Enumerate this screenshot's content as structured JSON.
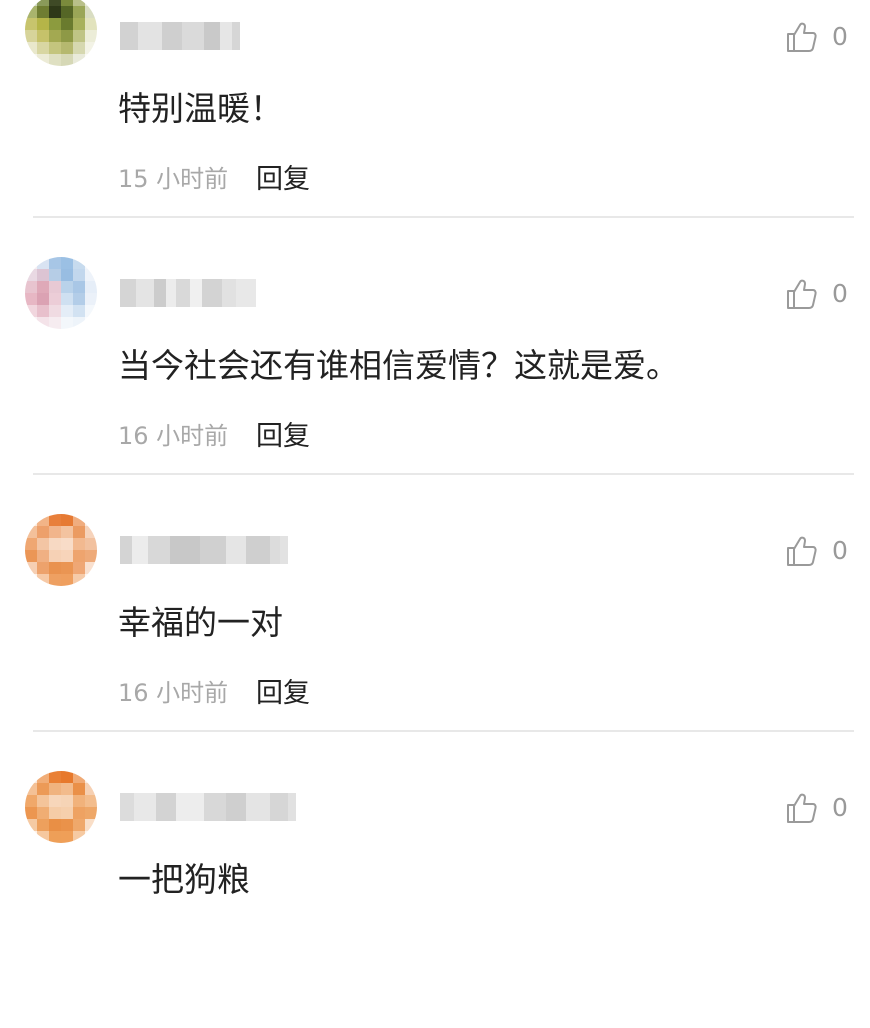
{
  "comments": [
    {
      "username": "",
      "content": "特别温暖！",
      "time": "15 小时前",
      "reply_label": "回复",
      "like_count": "0",
      "avatar_colors": [
        "#cfd8c4",
        "#8a9a5a",
        "#3f4a26",
        "#7b8a3c",
        "#b9c08a",
        "#e6ead6",
        "#a9b46d",
        "#6f7d32",
        "#2e3818",
        "#556626",
        "#9aa657",
        "#d9ddc2",
        "#c7c46d",
        "#b5b548",
        "#8c9b3e",
        "#6a7b2e",
        "#a8b15c",
        "#e2e3bd",
        "#d7d49a",
        "#c6c26a",
        "#a3a951",
        "#8e9946",
        "#bfc485",
        "#ecedd8",
        "#e9e8cc",
        "#d8d6a2",
        "#c4c57e",
        "#b5b86f",
        "#d6d8b0",
        "#f3f3e6",
        "#f6f6ee",
        "#ecebd6",
        "#dfe0c2",
        "#d6d8b6",
        "#e9eada",
        "#fafaf5"
      ],
      "name_colors": [
        "#d2d2d2",
        "#e3e3e3",
        "#cfcfcf",
        "#dadada",
        "#c9c9c9",
        "#e6e6e6",
        "#d6d6d6"
      ]
    },
    {
      "username": "",
      "content": "当今社会还有谁相信爱情？这就是爱。",
      "time": "16 小时前",
      "reply_label": "回复",
      "like_count": "0",
      "avatar_colors": [
        "#f4eef2",
        "#d9e3f2",
        "#a7c6e6",
        "#9bc0e4",
        "#c7dbee",
        "#f2f6fb",
        "#e9d9e3",
        "#dcc4d3",
        "#b6cde6",
        "#98bde2",
        "#c2d7ed",
        "#eef3fa",
        "#e8c4cf",
        "#dfa9b8",
        "#e8c9d4",
        "#b9d2ea",
        "#a9c7e6",
        "#e6eef8",
        "#e7b7c4",
        "#dba2b3",
        "#eccdd7",
        "#cfe0f1",
        "#b3cde8",
        "#ebf1f9",
        "#f1d6de",
        "#e8c0cc",
        "#f0dbe2",
        "#e4edf7",
        "#d2e2f2",
        "#f4f8fc",
        "#faf2f5",
        "#f4e3e9",
        "#f6ecf0",
        "#f3f7fb",
        "#eef4fa",
        "#fbfcfe"
      ],
      "name_colors": [
        "#d5d5d5",
        "#e4e4e4",
        "#cccccc",
        "#ececec",
        "#d9d9d9",
        "#f0f0f0",
        "#d3d3d3",
        "#e1e1e1",
        "#e8e8e8"
      ]
    },
    {
      "username": "",
      "content": "幸福的一对",
      "time": "16 小时前",
      "reply_label": "回复",
      "like_count": "0",
      "avatar_colors": [
        "#fbe9dc",
        "#f2b487",
        "#e87f3b",
        "#e67a33",
        "#f0ad7f",
        "#fbeadf",
        "#f3c09a",
        "#eda06b",
        "#f1b58c",
        "#f3c3a0",
        "#eb9b62",
        "#f6d3bb",
        "#efa772",
        "#f3c5a4",
        "#f7d9c3",
        "#f8dcc8",
        "#f2b990",
        "#f2c19f",
        "#eb9656",
        "#f0b083",
        "#f6d1b5",
        "#f7d4ba",
        "#eea46e",
        "#eeaa79",
        "#f6cfb3",
        "#eda26c",
        "#e9924f",
        "#ea9553",
        "#efa775",
        "#f9e0cf",
        "#fdf3ec",
        "#f6c9a6",
        "#eea062",
        "#ef9f5f",
        "#f6cba9",
        "#fdf4ee"
      ],
      "name_colors": [
        "#d4d4d4",
        "#ececec",
        "#d8d8d8",
        "#c8c8c8",
        "#d0d0d0",
        "#e5e5e5",
        "#cfcfcf",
        "#dcdcdc",
        "#e2e2e2"
      ]
    },
    {
      "username": "",
      "content": "一把狗粮",
      "time": "",
      "reply_label": "",
      "like_count": "0",
      "avatar_colors": [
        "#fbe6d6",
        "#f1ad77",
        "#e98035",
        "#e7792c",
        "#f0aa75",
        "#fbe8da",
        "#f4c196",
        "#ec9a57",
        "#f0b37f",
        "#f2bb8c",
        "#ea9048",
        "#f6d0b2",
        "#f0a86a",
        "#f4c49a",
        "#f7d6ba",
        "#f6d4b6",
        "#f1b27b",
        "#f3bd8d",
        "#ec9650",
        "#f0ad73",
        "#f5cca7",
        "#f6cfac",
        "#eea262",
        "#eea768",
        "#f5caa3",
        "#eda05d",
        "#e98f45",
        "#ea924a",
        "#efa86b",
        "#f9dec7",
        "#fdf1e7",
        "#f6c89f",
        "#ee9f58",
        "#ef9f58",
        "#f6caa2",
        "#fdf3eb"
      ],
      "name_colors": [
        "#dcdcdc",
        "#e8e8e8",
        "#d3d3d3",
        "#ededed",
        "#d8d8d8",
        "#cfcfcf",
        "#e4e4e4",
        "#d6d6d6",
        "#e1e1e1"
      ]
    }
  ]
}
